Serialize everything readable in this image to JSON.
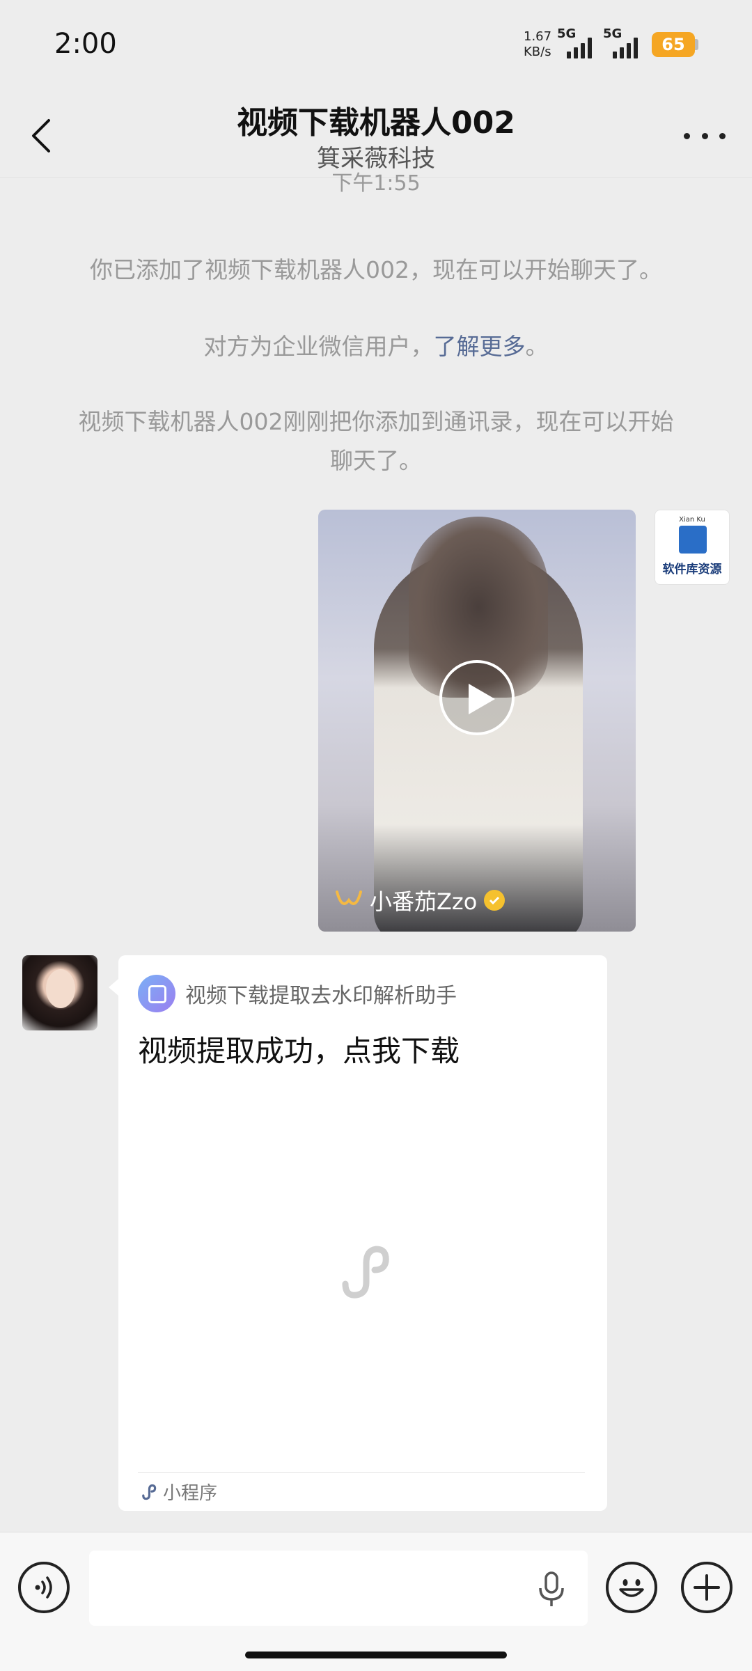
{
  "status_bar": {
    "time": "2:00",
    "net_speed_value": "1.67",
    "net_speed_unit": "KB/s",
    "signal_1_label": "5G",
    "signal_2_label": "5G",
    "battery": "65",
    "battery_color": "#f5a623"
  },
  "header": {
    "title": "视频下载机器人002",
    "subtitle": "箕采薇科技",
    "back_icon": "chevron-left-icon",
    "more_icon": "more-dots-icon"
  },
  "messages": {
    "timestamp": "下午1:55",
    "system_1": "你已添加了视频下载机器人002，现在可以开始聊天了。",
    "system_2_prefix": "对方为企业微信用户，",
    "system_2_link": "了解更多",
    "system_2_suffix": "。",
    "system_3": "视频下载机器人002刚刚把你添加到通讯录，现在可以开始聊天了。"
  },
  "video_message": {
    "author": "小番茄Zzo",
    "author_logo": "channels-icon",
    "verified_icon": "verified-badge-icon",
    "play_icon": "play-icon"
  },
  "my_avatar": {
    "label_top": "Xian Ku",
    "label": "软件库资源"
  },
  "mini_program_card": {
    "app_name": "视频下载提取去水印解析助手",
    "title": "视频提取成功，点我下载",
    "footer_label": "小程序",
    "placeholder_icon": "mini-program-icon"
  },
  "input_bar": {
    "text_value": "",
    "voice_icon": "voice-icon",
    "mic_icon": "microphone-icon",
    "emoji_icon": "emoji-icon",
    "plus_icon": "plus-icon"
  },
  "colors": {
    "background": "#ededed",
    "link": "#576b95",
    "system_text": "#999999"
  }
}
